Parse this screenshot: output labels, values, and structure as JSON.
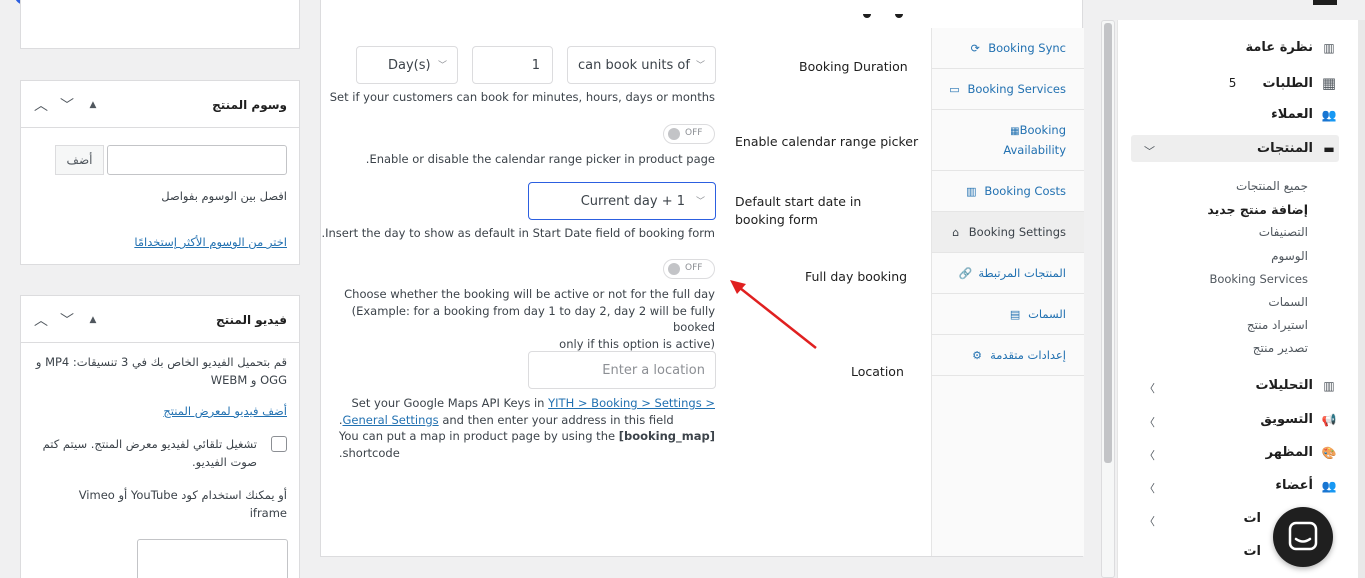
{
  "left_sidebar": {
    "tags_box": {
      "title": "وسوم المنتج",
      "add_button": "أضف",
      "hint": "افصل بين الوسوم بفواصل",
      "choose_link": "اختر من الوسوم الأكثر إستخدامًا"
    },
    "video_box": {
      "title": "فيديو المنتج",
      "upload_text": "قم بتحميل الفيديو الخاص بك في 3 تنسيقات: MP4 و OGG و WEBM",
      "add_link": "أضف فيديو لمعرض المنتج",
      "autoplay_label": "تشغيل تلقائي لفيديو معرض المنتج. سيتم كتم صوت الفيديو.",
      "embed_text": "أو يمكنك استخدام كود YouTube أو Vimeo iframe"
    }
  },
  "booking_tabs": [
    {
      "label": "Booking Sync",
      "icon": "sync-icon"
    },
    {
      "label": "Booking Services",
      "icon": "services-icon"
    },
    {
      "label": "Booking Availability",
      "icon": "calendar-icon"
    },
    {
      "label": "Booking Costs",
      "icon": "costs-chart-icon"
    },
    {
      "label": "Booking Settings",
      "icon": "home-settings-icon",
      "active": true
    },
    {
      "label": "المنتجات المرتبطة",
      "icon": "link-icon"
    },
    {
      "label": "السمات",
      "icon": "attributes-icon"
    },
    {
      "label": "إعدادات متقدمة",
      "icon": "gear-icon"
    }
  ],
  "settings": {
    "duration": {
      "label": "Booking Duration",
      "mode": "can book units of",
      "quantity": "1",
      "unit": "Day(s)",
      "desc": "Set if your customers can book for minutes, hours, days or months"
    },
    "range_picker": {
      "label": "Enable calendar range picker",
      "toggle": "OFF",
      "desc": "Enable or disable the calendar range picker in product page."
    },
    "start_date": {
      "label": "Default start date in booking form",
      "value": "Current day + 1",
      "desc": "Insert the day to show as default in Start Date field of booking form."
    },
    "full_day": {
      "label": "Full day booking",
      "toggle": "OFF",
      "desc_1": "Choose whether the booking will be active or not for the full day",
      "desc_2": "(Example: for a booking from day 1 to day 2, day 2 will be fully booked",
      "desc_3": "only if this option is active)"
    },
    "location": {
      "label": "Location",
      "placeholder": "Enter a location",
      "desc_prefix": "Set your Google Maps API Keys in",
      "desc_link_1": "YITH > Booking > Settings >",
      "desc_link_2": "General Settings",
      "desc_mid": "and then enter your address in this field.",
      "desc_3a": "You can put a map in product page by using the",
      "desc_3b": "[booking_map]",
      "desc_4": "shortcode."
    }
  },
  "admin_nav": {
    "overview": "نظرة عامة",
    "orders": "الطلبات",
    "orders_badge": "5",
    "customers": "العملاء",
    "products": "المنتجات",
    "products_sub": [
      "جميع المنتجات",
      "إضافة منتج جديد",
      "التصنيفات",
      "الوسوم",
      "Booking Services",
      "السمات",
      "استيراد منتج",
      "تصدير منتج"
    ],
    "analytics": "التحليلات",
    "marketing": "التسويق",
    "appearance": "المظهر",
    "members": "أعضاء",
    "partial_1": "ات",
    "partial_2": "ات"
  },
  "colors": {
    "accent": "#2271b1",
    "arrow": "#e02020",
    "focus_border": "#2c5fe0"
  }
}
